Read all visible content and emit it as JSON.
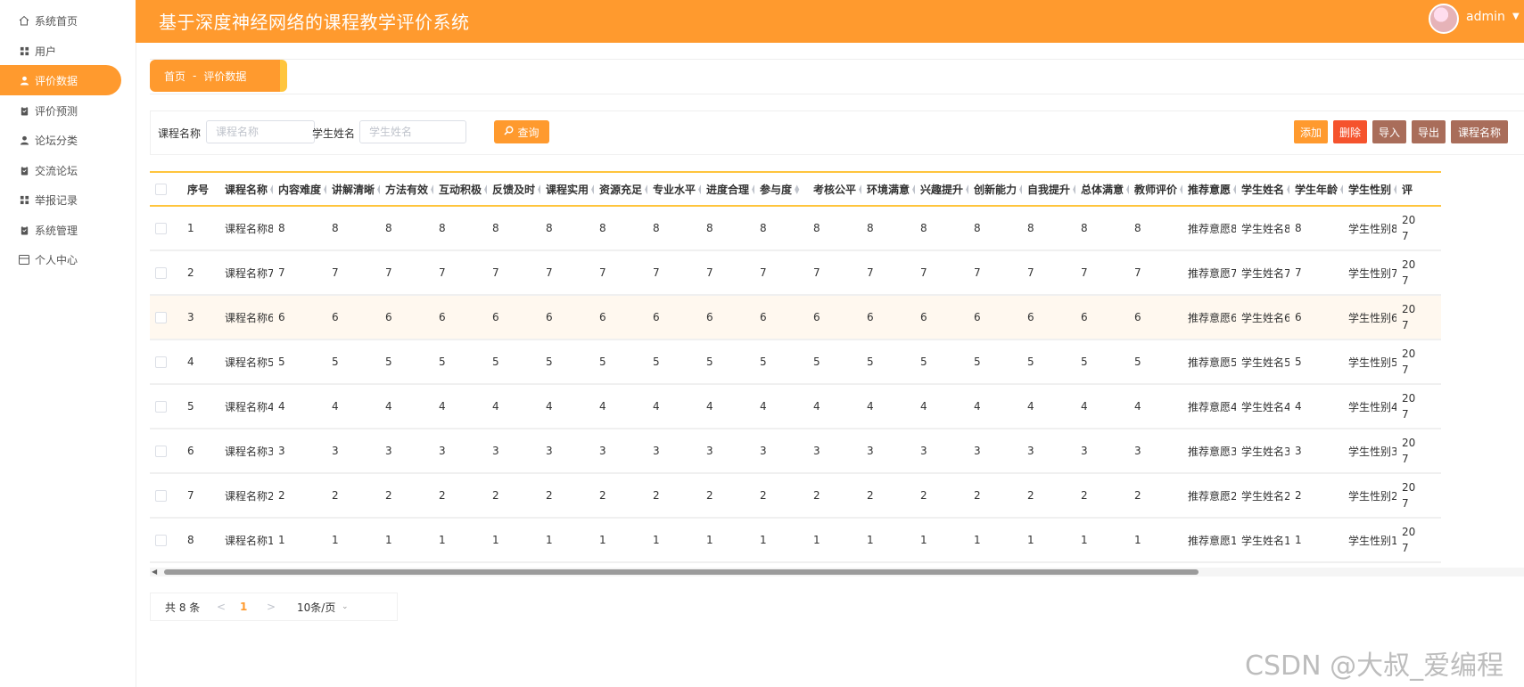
{
  "header": {
    "title": "基于深度神经网络的课程教学评价系统",
    "user": "admin"
  },
  "sidebar": {
    "items": [
      {
        "label": "系统首页",
        "icon": "home-icon"
      },
      {
        "label": "用户",
        "icon": "grid-icon"
      },
      {
        "label": "评价数据",
        "icon": "user-icon",
        "active": true
      },
      {
        "label": "评价预测",
        "icon": "clipboard-icon"
      },
      {
        "label": "论坛分类",
        "icon": "user-icon"
      },
      {
        "label": "交流论坛",
        "icon": "clipboard-icon"
      },
      {
        "label": "举报记录",
        "icon": "grid-icon"
      },
      {
        "label": "系统管理",
        "icon": "clipboard-icon"
      },
      {
        "label": "个人中心",
        "icon": "card-icon"
      }
    ]
  },
  "breadcrumb": {
    "home": "首页",
    "separator": "-",
    "current": "评价数据"
  },
  "search": {
    "course_label": "课程名称",
    "course_placeholder": "课程名称",
    "student_label": "学生姓名",
    "student_placeholder": "学生姓名",
    "query_label": "查询"
  },
  "actions": {
    "add": "添加",
    "delete": "删除",
    "import": "导入",
    "export": "导出",
    "course_name": "课程名称"
  },
  "colors": {
    "accent": "#ff9a2e",
    "delete": "#f5532d",
    "brown": "#a96d5a",
    "header_border": "#ffc53d"
  },
  "table": {
    "columns": [
      "序号",
      "课程名称",
      "内容难度",
      "讲解清晰",
      "方法有效",
      "互动积极",
      "反馈及时",
      "课程实用",
      "资源充足",
      "专业水平",
      "进度合理",
      "参与度",
      "考核公平",
      "环境满意",
      "兴趣提升",
      "创新能力",
      "自我提升",
      "总体满意",
      "教师评价",
      "推荐意愿",
      "学生姓名",
      "学生年龄",
      "学生性别",
      "评"
    ],
    "rows": [
      [
        "1",
        "课程名称8",
        "8",
        "8",
        "8",
        "8",
        "8",
        "8",
        "8",
        "8",
        "8",
        "8",
        "8",
        "8",
        "8",
        "8",
        "8",
        "8",
        "8",
        "推荐意愿8",
        "学生姓名8",
        "8",
        "学生性别8",
        "20",
        "7"
      ],
      [
        "2",
        "课程名称7",
        "7",
        "7",
        "7",
        "7",
        "7",
        "7",
        "7",
        "7",
        "7",
        "7",
        "7",
        "7",
        "7",
        "7",
        "7",
        "7",
        "7",
        "推荐意愿7",
        "学生姓名7",
        "7",
        "学生性别7",
        "20",
        "7"
      ],
      [
        "3",
        "课程名称6",
        "6",
        "6",
        "6",
        "6",
        "6",
        "6",
        "6",
        "6",
        "6",
        "6",
        "6",
        "6",
        "6",
        "6",
        "6",
        "6",
        "6",
        "推荐意愿6",
        "学生姓名6",
        "6",
        "学生性别6",
        "20",
        "7"
      ],
      [
        "4",
        "课程名称5",
        "5",
        "5",
        "5",
        "5",
        "5",
        "5",
        "5",
        "5",
        "5",
        "5",
        "5",
        "5",
        "5",
        "5",
        "5",
        "5",
        "5",
        "推荐意愿5",
        "学生姓名5",
        "5",
        "学生性别5",
        "20",
        "7"
      ],
      [
        "5",
        "课程名称4",
        "4",
        "4",
        "4",
        "4",
        "4",
        "4",
        "4",
        "4",
        "4",
        "4",
        "4",
        "4",
        "4",
        "4",
        "4",
        "4",
        "4",
        "推荐意愿4",
        "学生姓名4",
        "4",
        "学生性别4",
        "20",
        "7"
      ],
      [
        "6",
        "课程名称3",
        "3",
        "3",
        "3",
        "3",
        "3",
        "3",
        "3",
        "3",
        "3",
        "3",
        "3",
        "3",
        "3",
        "3",
        "3",
        "3",
        "3",
        "推荐意愿3",
        "学生姓名3",
        "3",
        "学生性别3",
        "20",
        "7"
      ],
      [
        "7",
        "课程名称2",
        "2",
        "2",
        "2",
        "2",
        "2",
        "2",
        "2",
        "2",
        "2",
        "2",
        "2",
        "2",
        "2",
        "2",
        "2",
        "2",
        "2",
        "推荐意愿2",
        "学生姓名2",
        "2",
        "学生性别2",
        "20",
        "7"
      ],
      [
        "8",
        "课程名称1",
        "1",
        "1",
        "1",
        "1",
        "1",
        "1",
        "1",
        "1",
        "1",
        "1",
        "1",
        "1",
        "1",
        "1",
        "1",
        "1",
        "1",
        "推荐意愿1",
        "学生姓名1",
        "1",
        "学生性别1",
        "20",
        "7"
      ]
    ]
  },
  "pagination": {
    "total": "共 8 条",
    "prev": "<",
    "page": "1",
    "next": ">",
    "page_size": "10条/页"
  },
  "watermark": "CSDN @大叔_爱编程"
}
